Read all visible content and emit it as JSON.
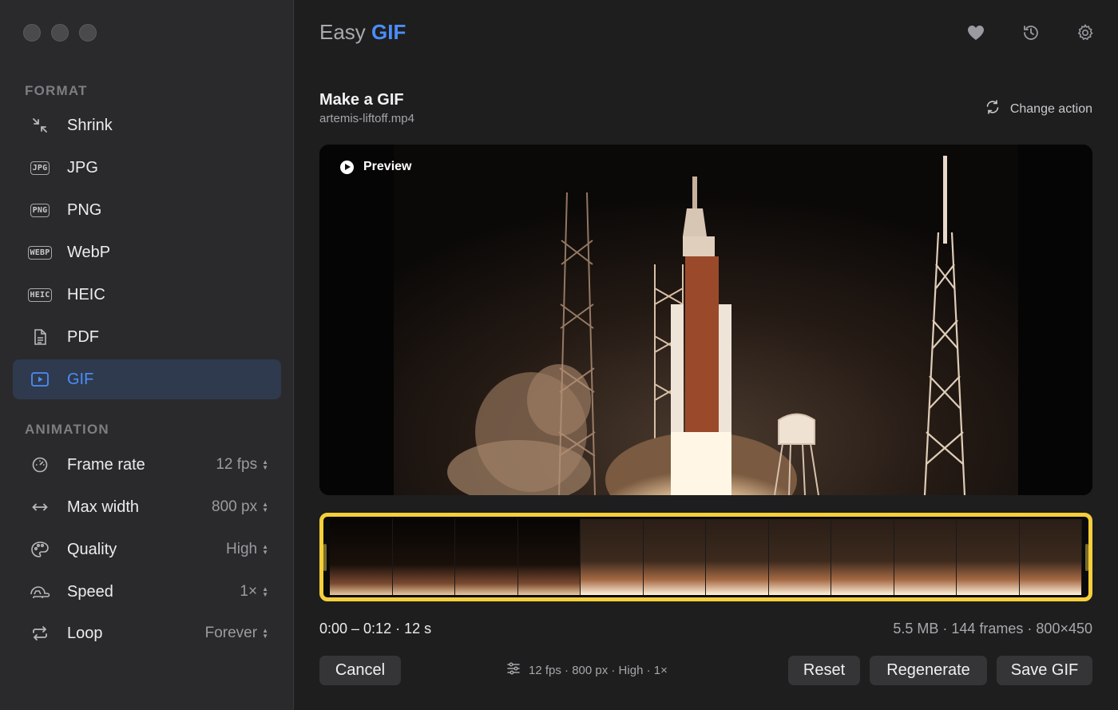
{
  "window": {
    "title_prefix": "Easy",
    "title_accent": "GIF"
  },
  "sidebar": {
    "format_title": "FORMAT",
    "formats": [
      {
        "label": "Shrink",
        "icon": "shrink-icon"
      },
      {
        "label": "JPG",
        "icon": "jpg-badge-icon",
        "badge": "JPG"
      },
      {
        "label": "PNG",
        "icon": "png-badge-icon",
        "badge": "PNG"
      },
      {
        "label": "WebP",
        "icon": "webp-badge-icon",
        "badge": "WEBP"
      },
      {
        "label": "HEIC",
        "icon": "heic-badge-icon",
        "badge": "HEIC"
      },
      {
        "label": "PDF",
        "icon": "document-icon"
      },
      {
        "label": "GIF",
        "icon": "play-square-icon",
        "active": true
      }
    ],
    "animation_title": "ANIMATION",
    "settings": [
      {
        "label": "Frame rate",
        "value": "12 fps",
        "icon": "gauge-icon"
      },
      {
        "label": "Max width",
        "value": "800 px",
        "icon": "horizontal-arrows-icon"
      },
      {
        "label": "Quality",
        "value": "High",
        "icon": "palette-icon"
      },
      {
        "label": "Speed",
        "value": "1×",
        "icon": "tortoise-icon"
      },
      {
        "label": "Loop",
        "value": "Forever",
        "icon": "repeat-icon"
      }
    ]
  },
  "header": {
    "icons": [
      "heart-icon",
      "history-icon",
      "gear-icon"
    ]
  },
  "main": {
    "title": "Make a GIF",
    "file_name": "artemis-liftoff.mp4",
    "change_action_label": "Change action",
    "preview_label": "Preview",
    "range": "0:00 – 0:12 · 12 s",
    "stats": "5.5 MB · 144 frames · 800×450",
    "settings_summary": "12 fps · 800 px · High · 1×",
    "buttons": {
      "cancel": "Cancel",
      "reset": "Reset",
      "regenerate": "Regenerate",
      "save": "Save GIF"
    }
  },
  "colors": {
    "accent": "#4b8df8",
    "trim_border": "#f5cf3b",
    "sidebar_bg": "#2a2a2c",
    "main_bg": "#1e1e1f"
  }
}
